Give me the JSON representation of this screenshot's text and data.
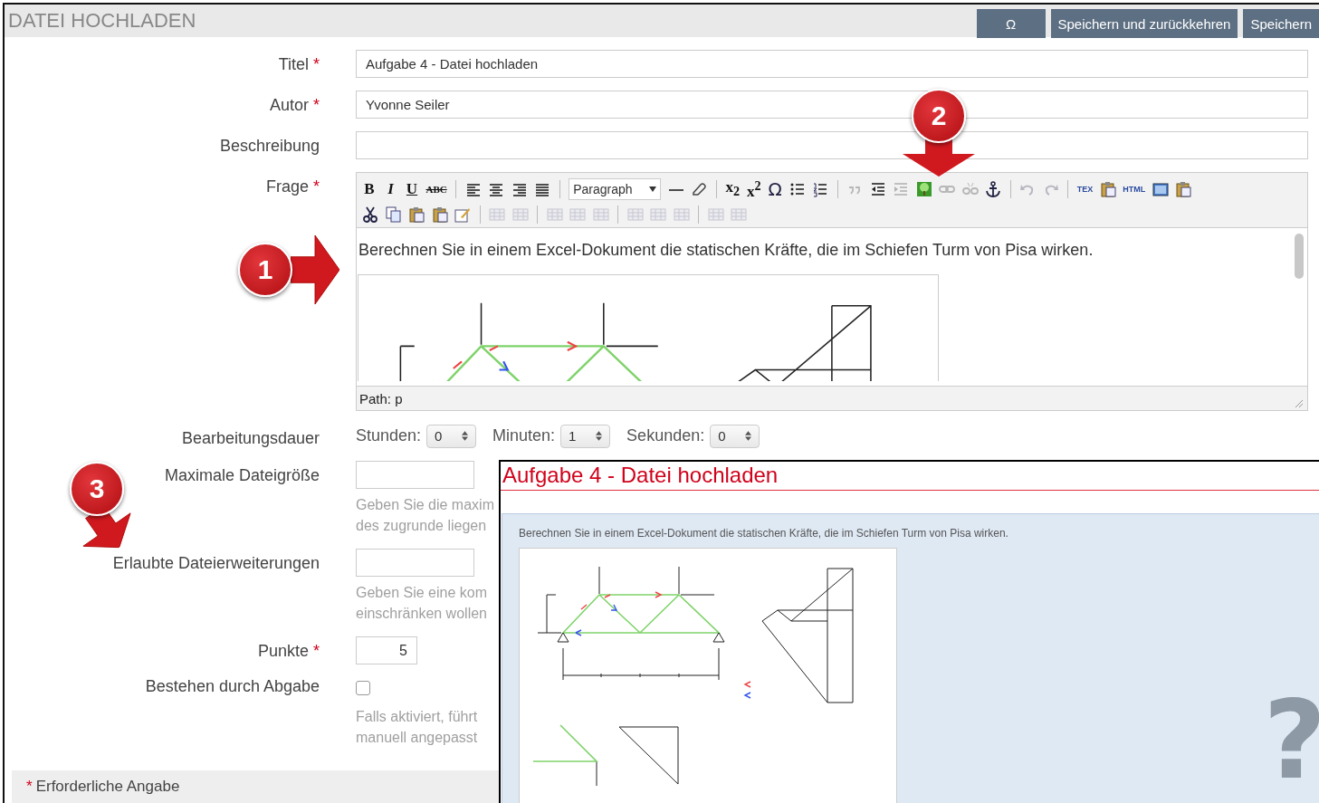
{
  "header": {
    "title": "DATEI HOCHLADEN",
    "buttons": [
      "Ω",
      "Speichern und zurückkehren",
      "Speichern"
    ]
  },
  "required_mark": "*",
  "fields": [
    {
      "kind": "text",
      "label": "Titel",
      "required": true,
      "value": "Aufgabe 4 - Datei hochladen"
    },
    {
      "kind": "text",
      "label": "Autor",
      "required": true,
      "value": "Yvonne Seiler"
    },
    {
      "kind": "text",
      "label": "Beschreibung",
      "required": false
    },
    {
      "kind": "editor",
      "label": "Frage",
      "required": true
    },
    {
      "kind": "duration",
      "label": "Bearbeitungsdauer",
      "required": false
    },
    {
      "kind": "short",
      "label": "Maximale Dateigröße",
      "required": false,
      "help": [
        "Geben Sie die maxim",
        "des zugrunde liegen"
      ]
    },
    {
      "kind": "short",
      "label": "Erlaubte Dateierweiterungen",
      "required": false,
      "help": [
        "Geben Sie eine kom",
        "einschränken wollen"
      ]
    },
    {
      "kind": "number",
      "label": "Punkte",
      "required": true,
      "value": "5"
    },
    {
      "kind": "checkbox",
      "label": "Bestehen durch Abgabe",
      "required": false,
      "checked": false,
      "help": [
        "Falls aktiviert, führt",
        "manuell angepasst"
      ]
    }
  ],
  "editor": {
    "toolbar": [
      [
        {
          "kind": "bold",
          "label": "B"
        },
        {
          "kind": "italic",
          "label": "I"
        },
        {
          "kind": "underline",
          "label": "U"
        },
        {
          "kind": "strike",
          "label": "ABC"
        },
        {
          "kind": "sep"
        },
        {
          "kind": "align-left",
          "disabled": false
        },
        {
          "kind": "align-center",
          "disabled": false
        },
        {
          "kind": "align-right",
          "disabled": false
        },
        {
          "kind": "justify",
          "disabled": false
        },
        {
          "kind": "sep"
        },
        {
          "kind": "select",
          "label": "Paragraph"
        },
        {
          "kind": "hr",
          "disabled": false
        },
        {
          "kind": "eraser",
          "disabled": false
        },
        {
          "kind": "sep"
        },
        {
          "kind": "glyph",
          "label": "x$_{2}$"
        },
        {
          "kind": "glyph",
          "label": "x$^{2}$"
        },
        {
          "kind": "omega",
          "label": "Ω"
        },
        {
          "kind": "bullets",
          "disabled": false
        },
        {
          "kind": "numbers",
          "disabled": false
        },
        {
          "kind": "sep"
        },
        {
          "kind": "quote",
          "disabled": true
        },
        {
          "kind": "outdent",
          "disabled": false
        },
        {
          "kind": "indent",
          "disabled": true
        },
        {
          "kind": "image",
          "disabled": false
        },
        {
          "kind": "link",
          "disabled": true
        },
        {
          "kind": "unlink",
          "disabled": true
        },
        {
          "kind": "anchor",
          "disabled": false
        },
        {
          "kind": "sep"
        },
        {
          "kind": "undo",
          "disabled": true
        },
        {
          "kind": "redo",
          "disabled": true
        },
        {
          "kind": "sep"
        },
        {
          "kind": "tiny",
          "label": "TEX"
        },
        {
          "kind": "clipboard",
          "disabled": false
        },
        {
          "kind": "tiny",
          "label": "HTML"
        },
        {
          "kind": "media",
          "disabled": false
        },
        {
          "kind": "clipboard",
          "disabled": false
        }
      ],
      [
        {
          "kind": "cut",
          "disabled": false
        },
        {
          "kind": "copy",
          "disabled": false
        },
        {
          "kind": "clipboard",
          "disabled": false
        },
        {
          "kind": "clipboard",
          "disabled": false
        },
        {
          "kind": "edit",
          "disabled": false
        },
        {
          "kind": "sep"
        },
        {
          "kind": "table",
          "disabled": true
        },
        {
          "kind": "table",
          "disabled": true
        },
        {
          "kind": "sep"
        },
        {
          "kind": "table",
          "disabled": true
        },
        {
          "kind": "table",
          "disabled": true
        },
        {
          "kind": "table",
          "disabled": true
        },
        {
          "kind": "sep"
        },
        {
          "kind": "table",
          "disabled": true
        },
        {
          "kind": "table",
          "disabled": true
        },
        {
          "kind": "table",
          "disabled": true
        },
        {
          "kind": "sep"
        },
        {
          "kind": "table",
          "disabled": true
        },
        {
          "kind": "table",
          "disabled": true
        }
      ]
    ],
    "content": "Berechnen Sie in einem Excel-Dokument die statischen Kräfte, die im Schiefen Turm von Pisa wirken.",
    "path": "Path: p"
  },
  "duration": [
    {
      "label": "Stunden:",
      "value": "0"
    },
    {
      "label": "Minuten:",
      "value": "1"
    },
    {
      "label": "Sekunden:",
      "value": "0"
    }
  ],
  "footer": {
    "text": "Erforderliche Angabe"
  },
  "preview": {
    "title": "Aufgabe 4 - Datei hochladen",
    "text": "Berechnen Sie in einem Excel-Dokument die statischen Kräfte, die im Schiefen Turm von Pisa wirken.",
    "help_glyph": "?"
  },
  "callouts": [
    {
      "number": "1"
    },
    {
      "number": "2"
    },
    {
      "number": "3"
    }
  ]
}
